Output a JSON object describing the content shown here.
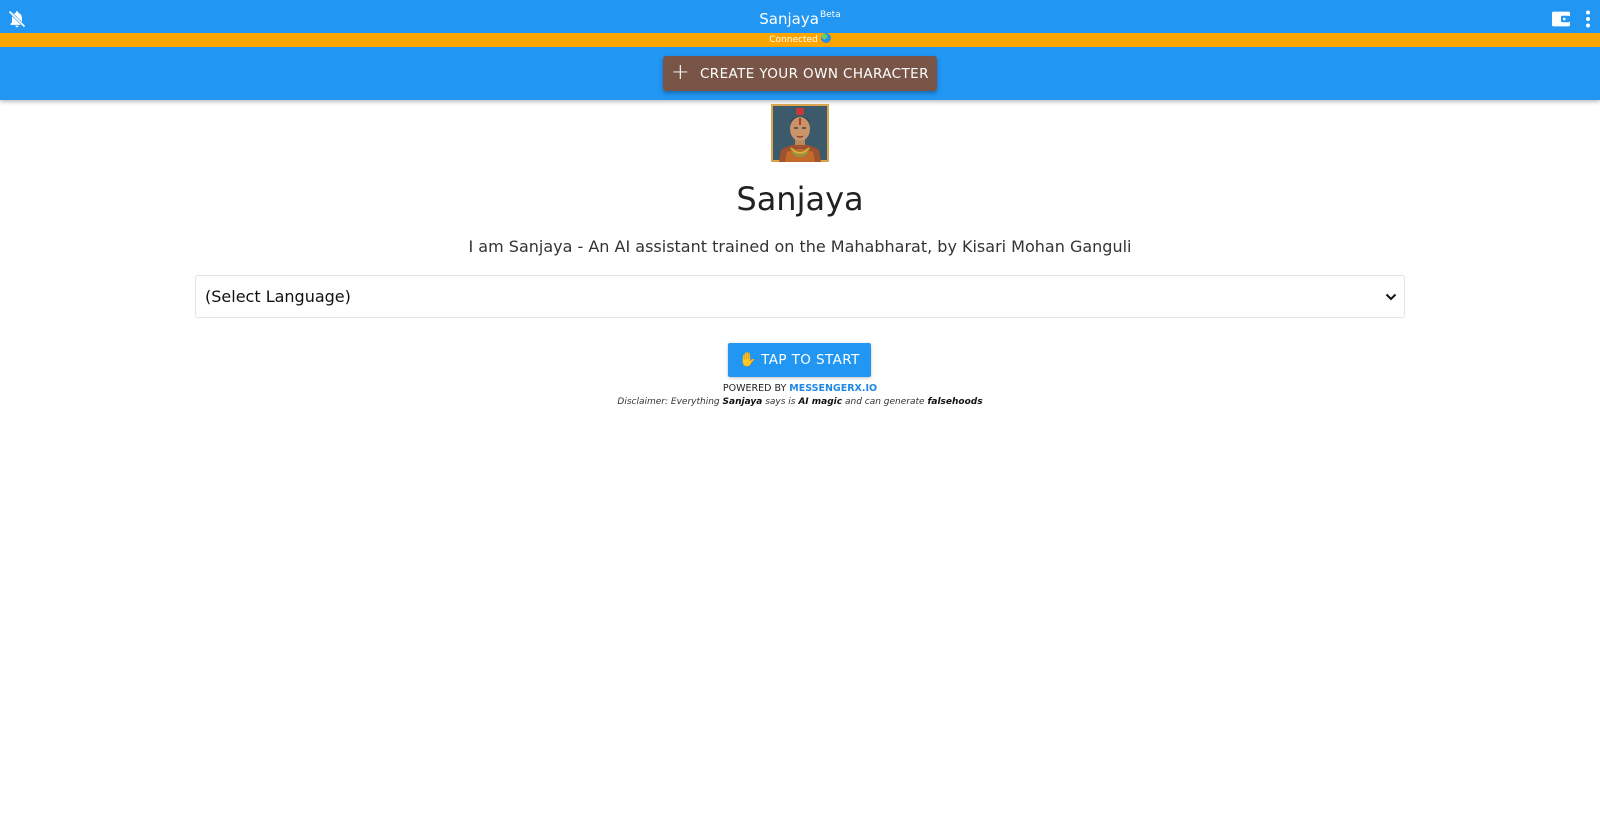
{
  "header": {
    "title": "Sanjaya",
    "title_badge": "Beta",
    "icons": {
      "left": "bell-off-icon",
      "right_wallet": "wallet-icon",
      "right_menu": "more-vertical-icon"
    }
  },
  "status": {
    "text": "Connected",
    "icon": "globe-icon"
  },
  "toolbar": {
    "create_label": "CREATE YOUR OWN CHARACTER",
    "create_icon": "plus-icon"
  },
  "character": {
    "name": "Sanjaya",
    "description": "I am Sanjaya - An AI assistant trained on the Mahabharat, by Kisari Mohan Ganguli"
  },
  "language_select": {
    "selected": "(Select Language)"
  },
  "start": {
    "label": "TAP TO START",
    "icon": "✋"
  },
  "footer": {
    "powered_prefix": "POWERED BY",
    "powered_link": "MESSENGERX.IO",
    "disclaimer_1": "Disclaimer: Everything",
    "disclaimer_name": "Sanjaya",
    "disclaimer_2": "says is",
    "disclaimer_magic": "AI magic",
    "disclaimer_3": "and can generate",
    "disclaimer_false": "falsehoods"
  },
  "colors": {
    "appbar": "#2196f3",
    "statusbar": "#ffa500",
    "create_button": "#795548",
    "start_button": "#2196f3",
    "link": "#1e88e5"
  }
}
